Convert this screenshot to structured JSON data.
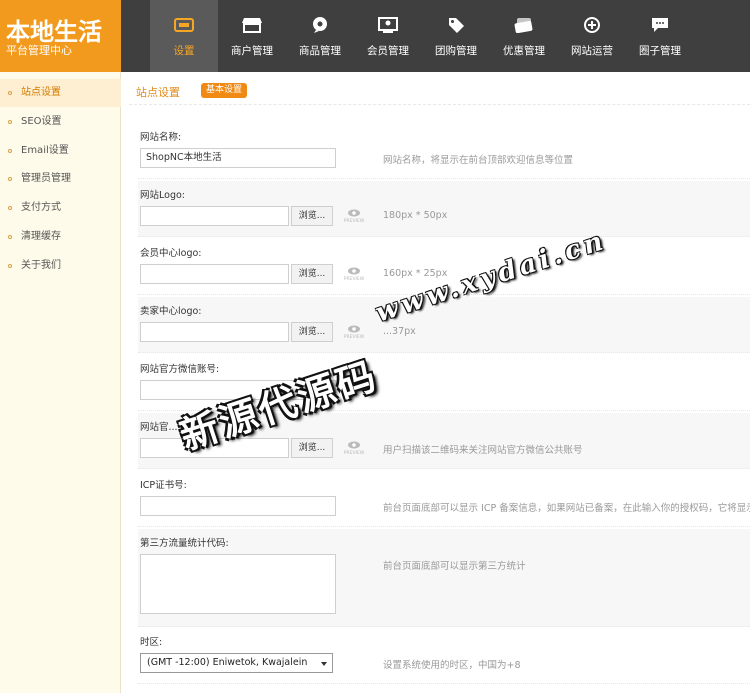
{
  "brand": {
    "title": "本地生活",
    "subtitle": "平台管理中心"
  },
  "topnav": [
    {
      "label": "设置",
      "icon": "settings-icon",
      "active": true
    },
    {
      "label": "商户管理",
      "icon": "store-icon"
    },
    {
      "label": "商品管理",
      "icon": "product-icon"
    },
    {
      "label": "会员管理",
      "icon": "member-icon"
    },
    {
      "label": "团购管理",
      "icon": "tag-icon"
    },
    {
      "label": "优惠管理",
      "icon": "coupon-icon"
    },
    {
      "label": "网站运营",
      "icon": "operation-icon"
    },
    {
      "label": "圈子管理",
      "icon": "chat-icon"
    }
  ],
  "sidebar": [
    {
      "label": "站点设置",
      "active": true
    },
    {
      "label": "SEO设置"
    },
    {
      "label": "Email设置"
    },
    {
      "label": "管理员管理"
    },
    {
      "label": "支付方式"
    },
    {
      "label": "清理缓存"
    },
    {
      "label": "关于我们"
    }
  ],
  "page": {
    "title": "站点设置",
    "tab": "基本设置"
  },
  "form": {
    "site_name": {
      "label": "网站名称:",
      "value": "ShopNC本地生活",
      "hint": "网站名称，将显示在前台顶部欢迎信息等位置"
    },
    "site_logo": {
      "label": "网站Logo:",
      "button": "浏览...",
      "hint": "180px * 50px"
    },
    "member_logo": {
      "label": "会员中心logo:",
      "button": "浏览...",
      "hint": "160px * 25px"
    },
    "seller_logo": {
      "label": "卖家中心logo:",
      "button": "浏览...",
      "hint": "...37px"
    },
    "wechat_account": {
      "label": "网站官方微信账号:",
      "value": ""
    },
    "wechat_qr": {
      "label": "网站官...",
      "button": "浏览...",
      "hint": "用户扫描该二维码来关注网站官方微信公共账号"
    },
    "icp": {
      "label": "ICP证书号:",
      "value": "",
      "hint": "前台页面底部可以显示 ICP 备案信息，如果网站已备案，在此输入你的授权码，它将显示在前台"
    },
    "stats_code": {
      "label": "第三方流量统计代码:",
      "value": "",
      "hint": "前台页面底部可以显示第三方统计"
    },
    "timezone": {
      "label": "时区:",
      "selected": "(GMT -12:00) Eniwetok, Kwajalein",
      "hint": "设置系统使用的时区，中国为+8"
    },
    "preview_text": "PREVIEW"
  },
  "watermark": {
    "url": "www.xydai.cn",
    "name": "新源代源码"
  },
  "colors": {
    "accent": "#f29a1d",
    "nav_bg": "#3f3f3f",
    "sidebar_bg": "#fffbea"
  }
}
